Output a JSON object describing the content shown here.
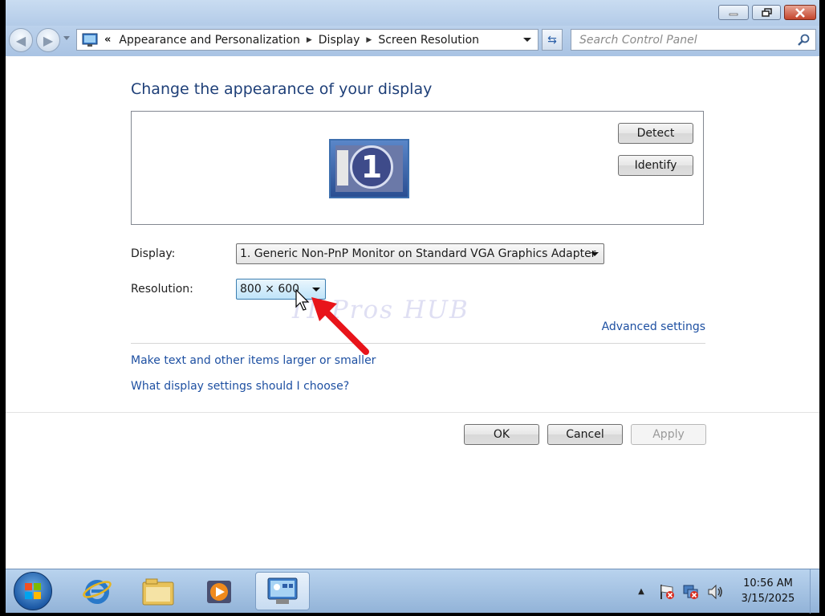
{
  "window": {
    "titlebar": {
      "buttons": [
        "minimize-icon",
        "restore-icon",
        "close-icon"
      ]
    },
    "address": {
      "prefix": "«",
      "crumbs": [
        "Appearance and Personalization",
        "Display",
        "Screen Resolution"
      ],
      "search_placeholder": "Search Control Panel"
    }
  },
  "main": {
    "heading": "Change the appearance of your display",
    "monitor": {
      "number": "1"
    },
    "detect_label": "Detect",
    "identify_label": "Identify",
    "display_label": "Display:",
    "display_value": "1. Generic Non-PnP Monitor on Standard VGA Graphics Adapter",
    "resolution_label": "Resolution:",
    "resolution_value": "800 × 600",
    "advanced_link": "Advanced settings",
    "links": [
      "Make text and other items larger or smaller",
      "What display settings should I choose?"
    ],
    "ok_label": "OK",
    "cancel_label": "Cancel",
    "apply_label": "Apply"
  },
  "overlay": {
    "watermark": "IT Pros HUB",
    "arrow_color": "#e8141a"
  },
  "taskbar": {
    "clock_time": "10:56 AM",
    "clock_date": "3/15/2025",
    "pinned": [
      "internet-explorer-icon",
      "windows-explorer-icon",
      "media-player-icon",
      "control-panel-icon"
    ]
  },
  "colors": {
    "heading": "#1e3f78",
    "link": "#1e50a2",
    "taskbar": "#a8c6e6"
  }
}
